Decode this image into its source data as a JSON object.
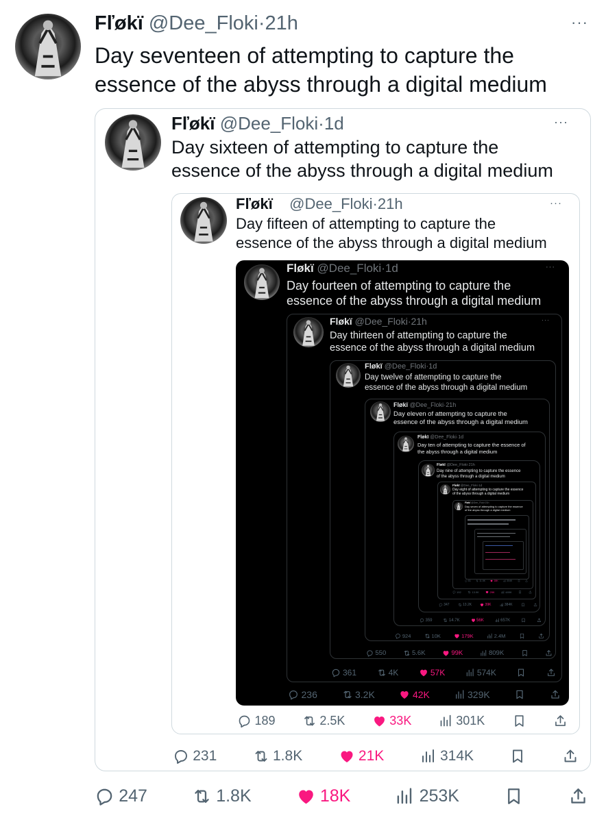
{
  "tweet": {
    "name": "Fľøkï",
    "handle": "@Dee_Floki",
    "time": "21h",
    "sep": "·",
    "more": "···",
    "text_line1": "Day seventeen of attempting to capture the",
    "text_line2": "essence of the abyss through a digital medium",
    "replies": "247",
    "retweets": "1.8K",
    "likes": "18K",
    "views": "253K"
  },
  "q1": {
    "name": "Fľøkï",
    "handle": "@Dee_Floki",
    "time": "1d",
    "sep": "·",
    "text_line1": "Day sixteen of attempting to capture the",
    "text_line2": "essence of the abyss through a digital medium",
    "replies": "231",
    "retweets": "1.8K",
    "likes": "21K",
    "views": "314K"
  },
  "q2": {
    "name": "Fľøkï",
    "handle": "@Dee_Floki",
    "time": "21h",
    "sep": "·",
    "text_line1": "Day fifteen of attempting to capture the",
    "text_line2": "essence of the abyss through a digital medium",
    "replies": "189",
    "retweets": "2.5K",
    "likes": "33K",
    "views": "301K"
  },
  "q3": {
    "name": "Fløkï",
    "handle": "@Dee_Floki",
    "time": "1d",
    "sep": "·",
    "text_line1": "Day fourteen of attempting to capture the",
    "text_line2": "essence of the abyss through a digital medium",
    "replies": "236",
    "retweets": "3.2K",
    "likes": "42K",
    "views": "329K"
  },
  "q4": {
    "name": "Fløkï",
    "handle": "@Dee_Floki",
    "time": "21h",
    "sep": "·",
    "text_line1": "Day thirteen of attempting to capture the",
    "text_line2": "essence of the abyss through a digital medium",
    "replies": "361",
    "retweets": "4K",
    "likes": "57K",
    "views": "574K"
  },
  "q5": {
    "name": "Fløkï",
    "handle": "@Dee_Floki",
    "time": "1d",
    "sep": "·",
    "text_line1": "Day twelve of attempting to capture the",
    "text_line2": "essence of the abyss through a digital medium",
    "replies": "550",
    "retweets": "5.6K",
    "likes": "99K",
    "views": "809K"
  },
  "q6": {
    "name": "Fløkï",
    "handle": "@Dee_Floki",
    "time": "21h",
    "sep": "·",
    "text_line1": "Day eleven of attempting to capture the",
    "text_line2": "essence of the abyss through a digital medium",
    "replies": "924",
    "retweets": "10K",
    "likes": "179K",
    "views": "2.4M"
  },
  "q7": {
    "name": "Fløkï",
    "handle": "@Dee_Floki",
    "time": "1d",
    "sep": "·",
    "text_line1": "Day ten of attempting to capture the essence of",
    "text_line2": "the abyss through a digital medium",
    "replies": "359",
    "retweets": "14.7K",
    "likes": "56K",
    "views": "657K"
  },
  "q8": {
    "name": "Fløkï",
    "handle": "@Dee_Floki",
    "time": "21h",
    "sep": "·",
    "text_line1": "Day nine of attempting to capture the essence",
    "text_line2": "of the abyss through a digital medium",
    "replies": "347",
    "retweets": "13.2K",
    "likes": "39K",
    "views": "384K"
  },
  "q9": {
    "name": "Fløkï",
    "handle": "@Dee_Floki",
    "time": "1d",
    "sep": "·",
    "text_line1": "Day eight of attempting to capture the essence",
    "text_line2": "of the abyss through a digital medium",
    "replies": "192",
    "retweets": "13.9K",
    "likes": "29K",
    "views": "489K"
  },
  "q10": {
    "name": "Fløkï",
    "handle": "@Dee_Floki",
    "time": "21h",
    "sep": "·",
    "text_line1": "Day seven of attempting to capture the essence",
    "text_line2": "of the abyss through a digital medium",
    "replies": "81",
    "retweets": "11.5K",
    "likes": "18K",
    "views": "304K"
  },
  "colors": {
    "like": "#f91880",
    "meta": "#536471",
    "dark": "#000000",
    "border": "#cfd9de"
  },
  "icons": [
    "reply-icon",
    "retweet-icon",
    "like-icon",
    "views-icon",
    "bookmark-icon",
    "share-icon",
    "more-icon"
  ]
}
